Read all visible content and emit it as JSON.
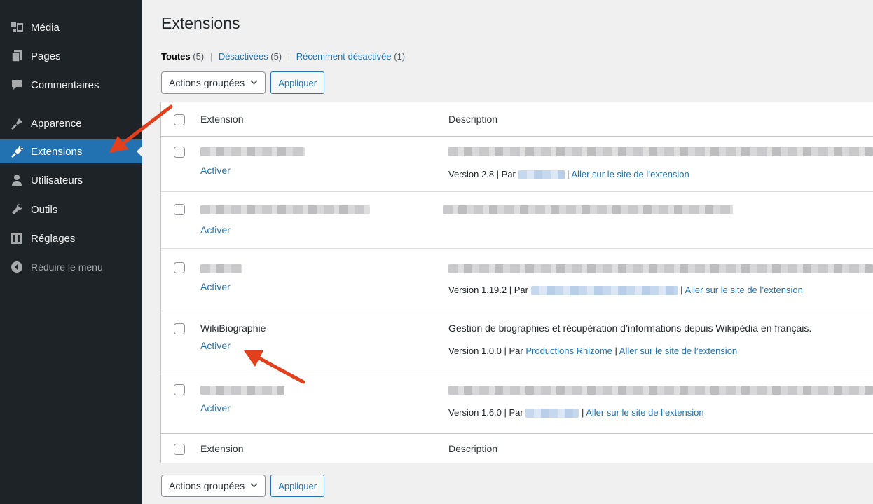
{
  "sidebar": {
    "items": [
      {
        "label": "Média",
        "icon": "media-icon"
      },
      {
        "label": "Pages",
        "icon": "pages-icon"
      },
      {
        "label": "Commentaires",
        "icon": "comments-icon"
      },
      {
        "label": "Apparence",
        "icon": "appearance-icon"
      },
      {
        "label": "Extensions",
        "icon": "plugins-icon",
        "current": true
      },
      {
        "label": "Utilisateurs",
        "icon": "users-icon"
      },
      {
        "label": "Outils",
        "icon": "tools-icon"
      },
      {
        "label": "Réglages",
        "icon": "settings-icon"
      },
      {
        "label": "Réduire le menu",
        "icon": "collapse-icon"
      }
    ]
  },
  "page": {
    "title": "Extensions",
    "filters": {
      "all": {
        "label": "Toutes",
        "count": "(5)"
      },
      "inactive": {
        "label": "Désactivées",
        "count": "(5)"
      },
      "recent": {
        "label": "Récemment désactivée",
        "count": "(1)"
      },
      "separator": "|"
    },
    "bulk": {
      "select_label": "Actions groupées",
      "apply_label": "Appliquer"
    }
  },
  "table": {
    "col_extension": "Extension",
    "col_description": "Description",
    "rows": [
      {
        "name": "",
        "action": "Activer",
        "meta": {
          "version": "Version 2.8 | Par ",
          "sep": " | ",
          "site": "Aller sur le site de l’extension"
        }
      },
      {
        "name": "",
        "action": "Activer"
      },
      {
        "name": "",
        "action": "Activer",
        "meta": {
          "version": "Version 1.19.2 | Par ",
          "sep": " | ",
          "site": "Aller sur le site de l’extension"
        }
      },
      {
        "name": "WikiBiographie",
        "action": "Activer",
        "description": "Gestion de biographies et récupération d’informations depuis Wikipédia en français.",
        "meta": {
          "version": "Version 1.0.0 | Par ",
          "author": "Productions Rhizome",
          "sep": " | ",
          "site": "Aller sur le site de l’extension"
        }
      },
      {
        "name": "",
        "action": "Activer",
        "meta": {
          "version": "Version 1.6.0 | Par ",
          "sep": " | ",
          "site": "Aller sur le site de l’extension"
        }
      }
    ]
  },
  "colors": {
    "sidebar_bg": "#1d2327",
    "accent": "#2271b1",
    "arrow": "#e2401c"
  }
}
